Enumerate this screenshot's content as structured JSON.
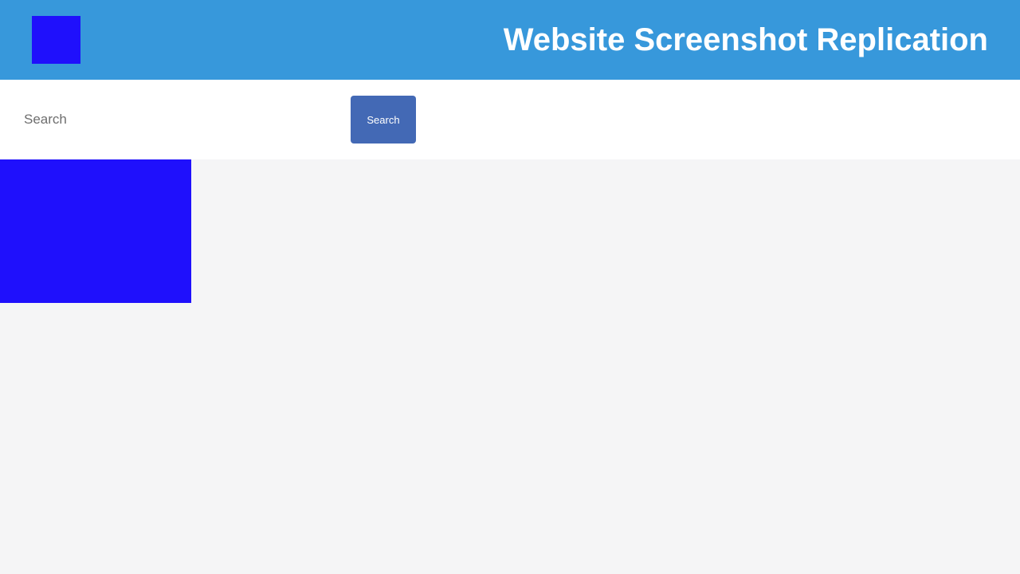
{
  "header": {
    "title": "Website Screenshot Replication",
    "background_color": "#3798db",
    "logo_color": "#1f10fc"
  },
  "search": {
    "placeholder": "Search",
    "value": "",
    "button_label": "Search",
    "button_color": "#4369b5"
  },
  "content": {
    "block_color": "#1f10fc",
    "page_background": "#f5f5f6"
  }
}
